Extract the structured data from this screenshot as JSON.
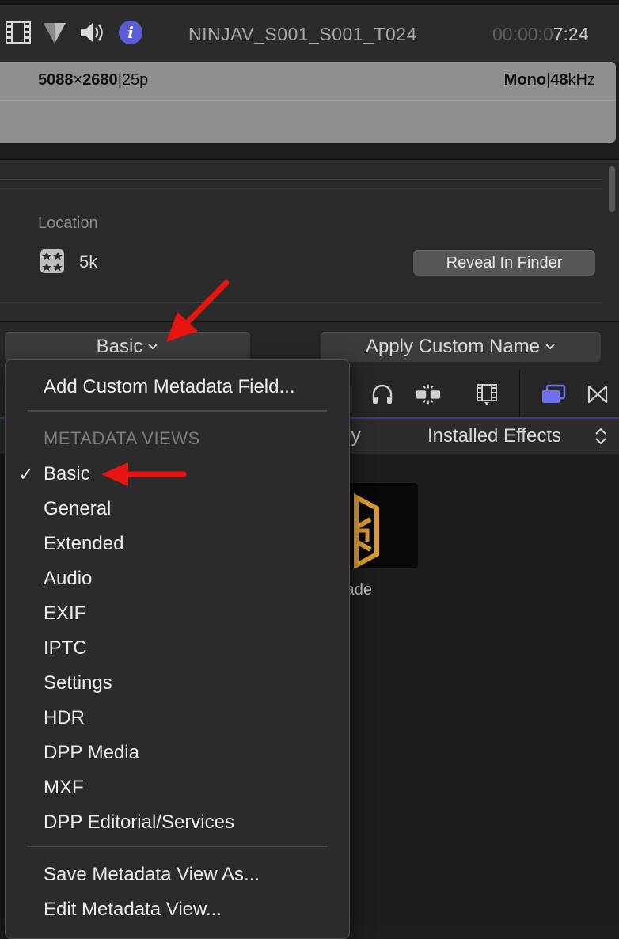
{
  "toolbar": {
    "icons": [
      "film-icon",
      "color-board-icon",
      "volume-icon",
      "info-icon"
    ],
    "clip_name": "NINJAV_S001_S001_T024",
    "timecode_dim": "00:00:0",
    "timecode_bright": "7:24",
    "info_accent": "#5b5bd6"
  },
  "format": {
    "width": "5088",
    "times": "×",
    "height": "2680",
    "sep": "|",
    "framerate": "25p",
    "channels": "Mono",
    "rate": "48",
    "rate_unit": "kHz"
  },
  "info": {
    "location_label": "Location",
    "library_icon": "library-icon",
    "library_name": "5k",
    "reveal_label": "Reveal In Finder"
  },
  "dropdowns": {
    "view_label": "Basic",
    "custom_name_label": "Apply Custom Name"
  },
  "browser": {
    "only_text": "nly",
    "effects_label": "Installed Effects",
    "thumb_label": "rade"
  },
  "menu": {
    "add_field": "Add Custom Metadata Field...",
    "section_header": "METADATA VIEWS",
    "checkmark": "✓",
    "selected": "Basic",
    "views": [
      "Basic",
      "General",
      "Extended",
      "Audio",
      "EXIF",
      "IPTC",
      "Settings",
      "HDR",
      "DPP Media",
      "MXF",
      "DPP Editorial/Services"
    ],
    "save_view": "Save Metadata View As...",
    "edit_view": "Edit Metadata View..."
  },
  "annotations": {
    "arrow_color": "#e8140f"
  }
}
